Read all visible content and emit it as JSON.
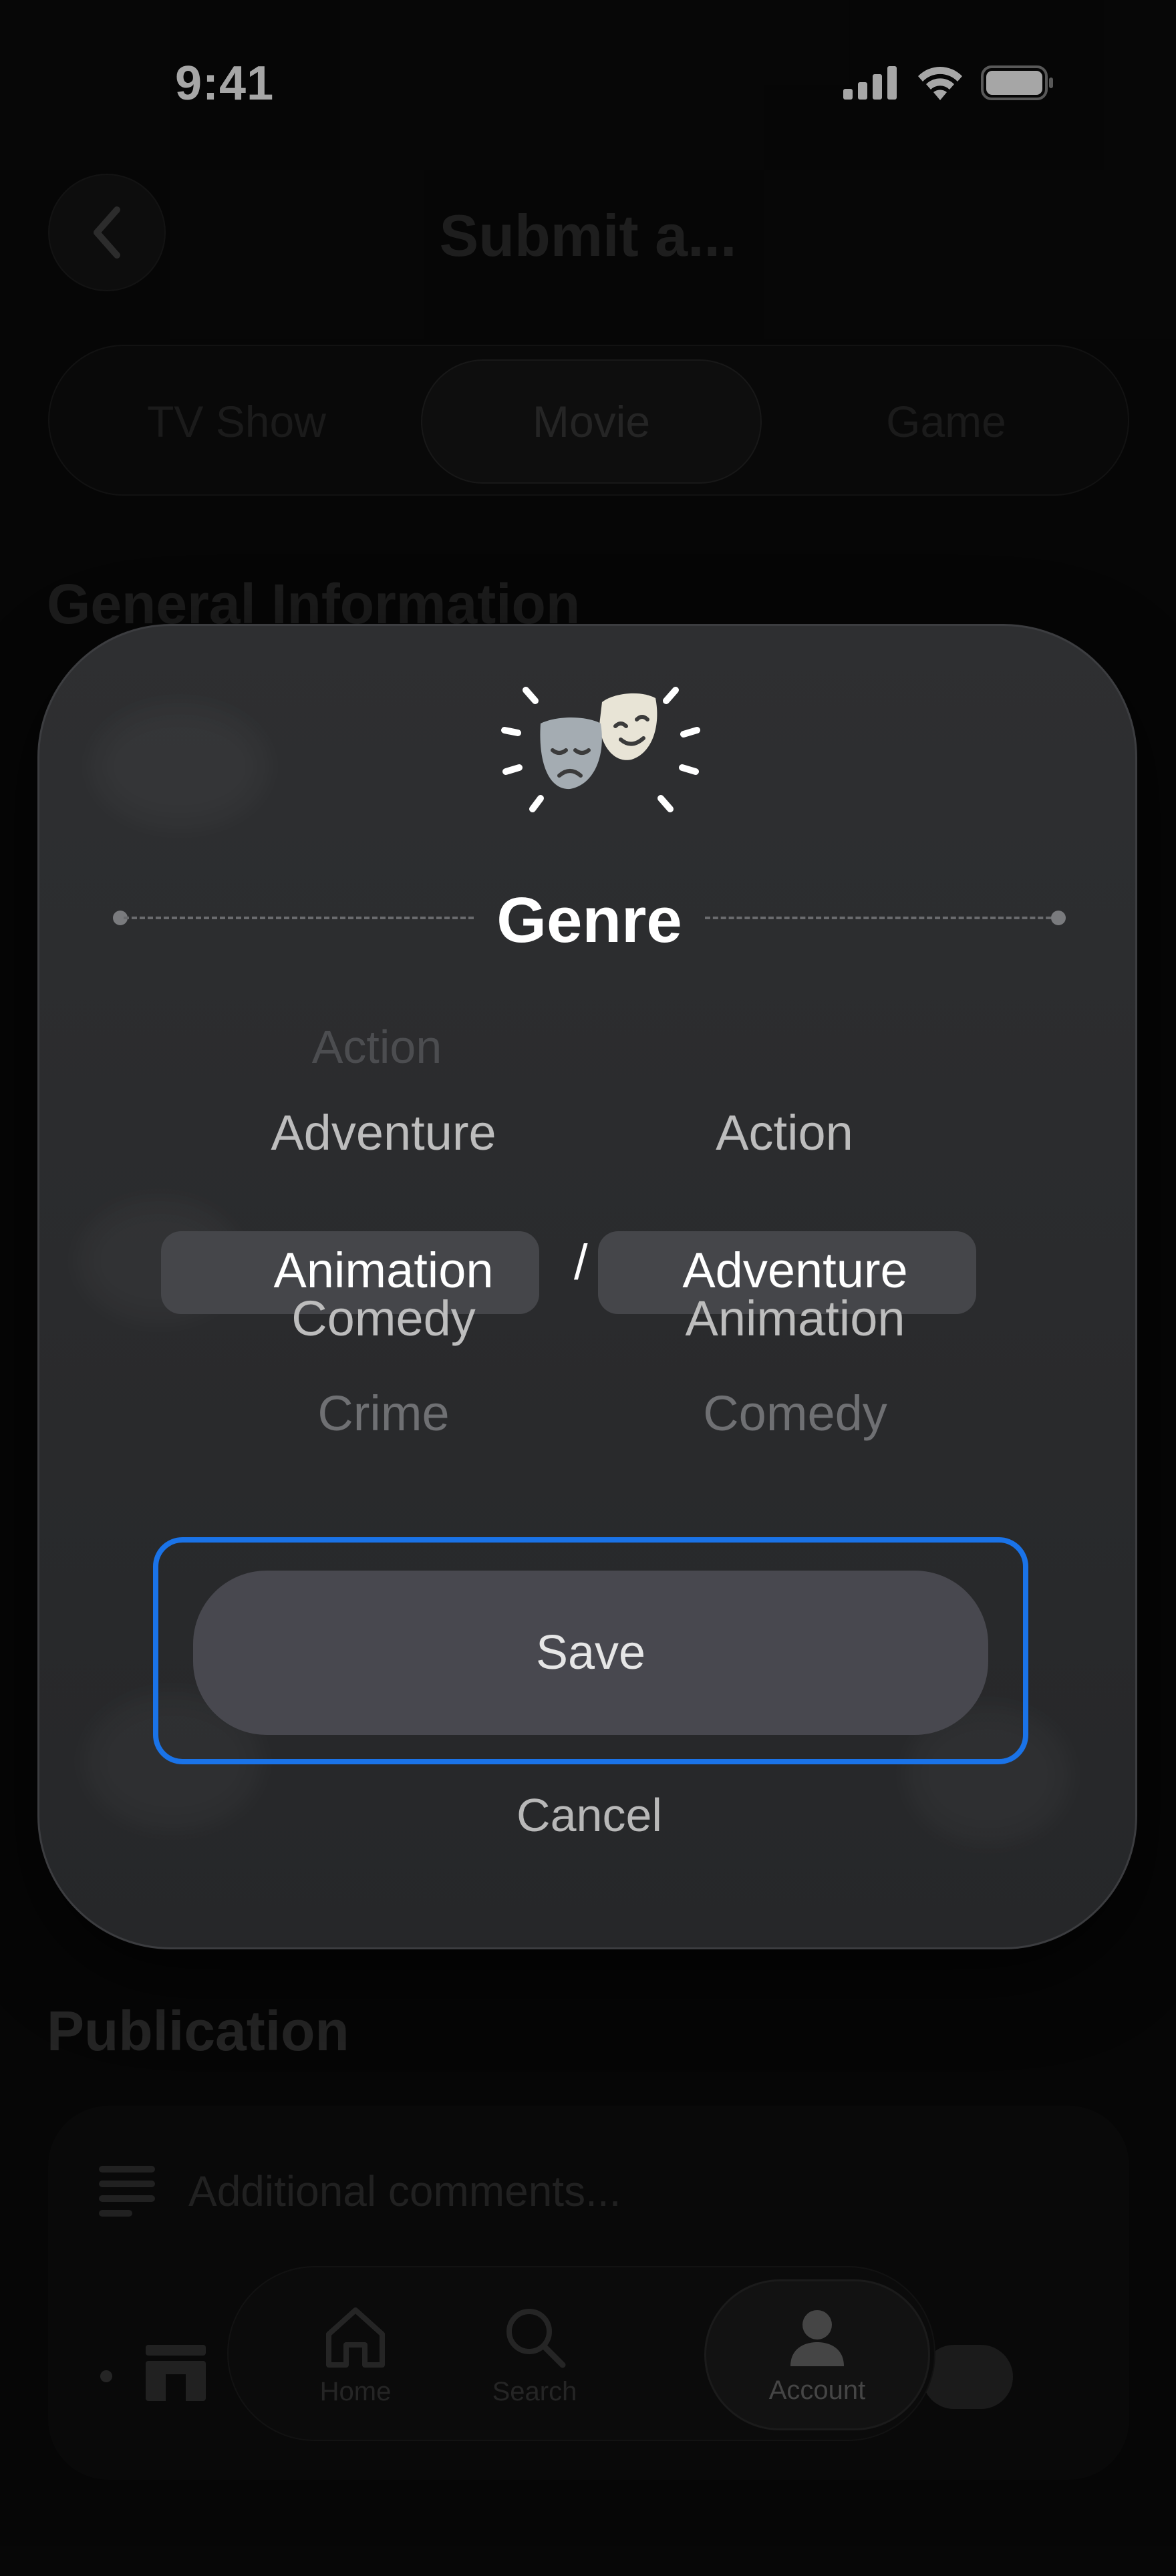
{
  "status_bar": {
    "time": "9:41"
  },
  "header": {
    "title": "Submit a..."
  },
  "segments": {
    "tv": "TV Show",
    "movie": "Movie",
    "game": "Game"
  },
  "sections": {
    "general": "General Information",
    "publication": "Publication"
  },
  "publication": {
    "comments_placeholder": "Additional comments..."
  },
  "tabbar": {
    "home": "Home",
    "search": "Search",
    "account": "Account"
  },
  "modal": {
    "title": "Genre",
    "separator": "/",
    "left_picker": {
      "items": [
        "Action",
        "Adventure",
        "Animation",
        "Comedy",
        "Crime"
      ],
      "selected": "Animation"
    },
    "right_picker": {
      "items": [
        "Action",
        "Adventure",
        "Animation",
        "Comedy"
      ],
      "selected": "Adventure"
    },
    "save_label": "Save",
    "cancel_label": "Cancel"
  },
  "colors": {
    "accent_focus": "#1a73e8",
    "modal_bg": "#2b2c2e",
    "save_bg": "#48484f"
  }
}
